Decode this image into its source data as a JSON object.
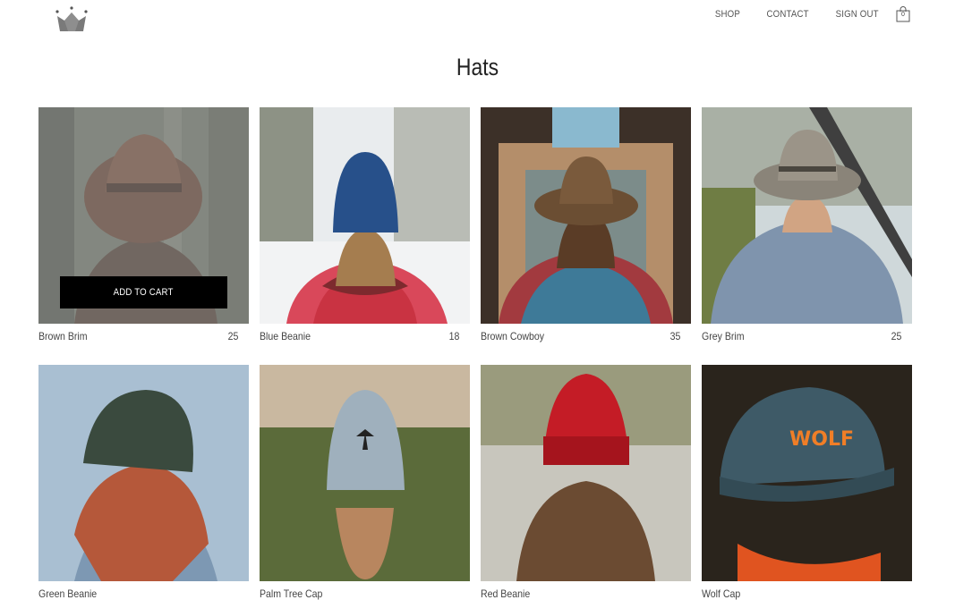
{
  "header": {
    "logo_icon": "crown-icon",
    "nav": [
      {
        "label": "SHOP"
      },
      {
        "label": "CONTACT"
      },
      {
        "label": "SIGN OUT"
      }
    ],
    "cart_icon": "shopping-bag-icon",
    "cart_count": "0"
  },
  "page_title": "Hats",
  "add_to_cart_label": "ADD TO CART",
  "products": [
    {
      "name": "Brown Brim",
      "price": "25"
    },
    {
      "name": "Blue Beanie",
      "price": "18"
    },
    {
      "name": "Brown Cowboy",
      "price": "35"
    },
    {
      "name": "Grey Brim",
      "price": "25"
    },
    {
      "name": "Green Beanie",
      "price": ""
    },
    {
      "name": "Palm Tree Cap",
      "price": ""
    },
    {
      "name": "Red Beanie",
      "price": ""
    },
    {
      "name": "Wolf Cap",
      "price": ""
    }
  ],
  "colors": {
    "button_bg": "#000000",
    "text": "#444444"
  }
}
